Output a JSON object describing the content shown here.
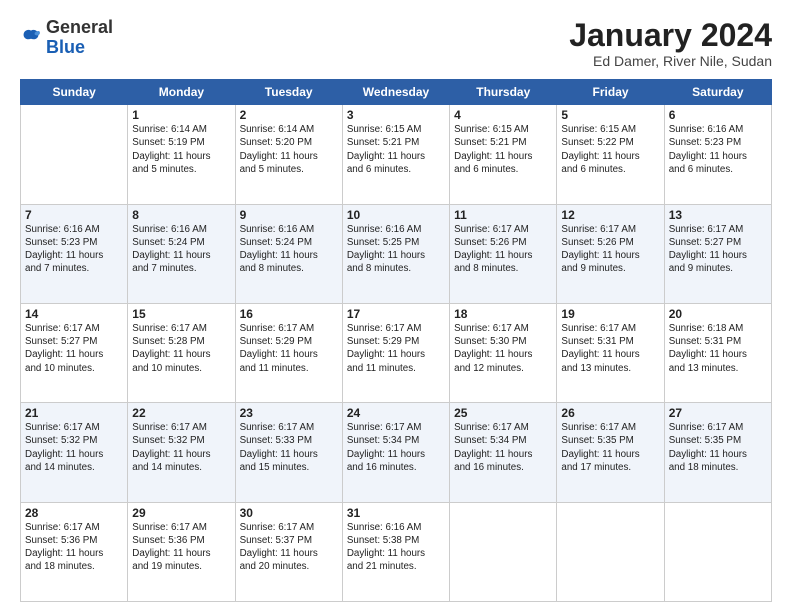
{
  "header": {
    "logo_general": "General",
    "logo_blue": "Blue",
    "month_title": "January 2024",
    "location": "Ed Damer, River Nile, Sudan"
  },
  "weekdays": [
    "Sunday",
    "Monday",
    "Tuesday",
    "Wednesday",
    "Thursday",
    "Friday",
    "Saturday"
  ],
  "weeks": [
    [
      {
        "day": "",
        "info": ""
      },
      {
        "day": "1",
        "info": "Sunrise: 6:14 AM\nSunset: 5:19 PM\nDaylight: 11 hours\nand 5 minutes."
      },
      {
        "day": "2",
        "info": "Sunrise: 6:14 AM\nSunset: 5:20 PM\nDaylight: 11 hours\nand 5 minutes."
      },
      {
        "day": "3",
        "info": "Sunrise: 6:15 AM\nSunset: 5:21 PM\nDaylight: 11 hours\nand 6 minutes."
      },
      {
        "day": "4",
        "info": "Sunrise: 6:15 AM\nSunset: 5:21 PM\nDaylight: 11 hours\nand 6 minutes."
      },
      {
        "day": "5",
        "info": "Sunrise: 6:15 AM\nSunset: 5:22 PM\nDaylight: 11 hours\nand 6 minutes."
      },
      {
        "day": "6",
        "info": "Sunrise: 6:16 AM\nSunset: 5:23 PM\nDaylight: 11 hours\nand 6 minutes."
      }
    ],
    [
      {
        "day": "7",
        "info": "Sunrise: 6:16 AM\nSunset: 5:23 PM\nDaylight: 11 hours\nand 7 minutes."
      },
      {
        "day": "8",
        "info": "Sunrise: 6:16 AM\nSunset: 5:24 PM\nDaylight: 11 hours\nand 7 minutes."
      },
      {
        "day": "9",
        "info": "Sunrise: 6:16 AM\nSunset: 5:24 PM\nDaylight: 11 hours\nand 8 minutes."
      },
      {
        "day": "10",
        "info": "Sunrise: 6:16 AM\nSunset: 5:25 PM\nDaylight: 11 hours\nand 8 minutes."
      },
      {
        "day": "11",
        "info": "Sunrise: 6:17 AM\nSunset: 5:26 PM\nDaylight: 11 hours\nand 8 minutes."
      },
      {
        "day": "12",
        "info": "Sunrise: 6:17 AM\nSunset: 5:26 PM\nDaylight: 11 hours\nand 9 minutes."
      },
      {
        "day": "13",
        "info": "Sunrise: 6:17 AM\nSunset: 5:27 PM\nDaylight: 11 hours\nand 9 minutes."
      }
    ],
    [
      {
        "day": "14",
        "info": "Sunrise: 6:17 AM\nSunset: 5:27 PM\nDaylight: 11 hours\nand 10 minutes."
      },
      {
        "day": "15",
        "info": "Sunrise: 6:17 AM\nSunset: 5:28 PM\nDaylight: 11 hours\nand 10 minutes."
      },
      {
        "day": "16",
        "info": "Sunrise: 6:17 AM\nSunset: 5:29 PM\nDaylight: 11 hours\nand 11 minutes."
      },
      {
        "day": "17",
        "info": "Sunrise: 6:17 AM\nSunset: 5:29 PM\nDaylight: 11 hours\nand 11 minutes."
      },
      {
        "day": "18",
        "info": "Sunrise: 6:17 AM\nSunset: 5:30 PM\nDaylight: 11 hours\nand 12 minutes."
      },
      {
        "day": "19",
        "info": "Sunrise: 6:17 AM\nSunset: 5:31 PM\nDaylight: 11 hours\nand 13 minutes."
      },
      {
        "day": "20",
        "info": "Sunrise: 6:18 AM\nSunset: 5:31 PM\nDaylight: 11 hours\nand 13 minutes."
      }
    ],
    [
      {
        "day": "21",
        "info": "Sunrise: 6:17 AM\nSunset: 5:32 PM\nDaylight: 11 hours\nand 14 minutes."
      },
      {
        "day": "22",
        "info": "Sunrise: 6:17 AM\nSunset: 5:32 PM\nDaylight: 11 hours\nand 14 minutes."
      },
      {
        "day": "23",
        "info": "Sunrise: 6:17 AM\nSunset: 5:33 PM\nDaylight: 11 hours\nand 15 minutes."
      },
      {
        "day": "24",
        "info": "Sunrise: 6:17 AM\nSunset: 5:34 PM\nDaylight: 11 hours\nand 16 minutes."
      },
      {
        "day": "25",
        "info": "Sunrise: 6:17 AM\nSunset: 5:34 PM\nDaylight: 11 hours\nand 16 minutes."
      },
      {
        "day": "26",
        "info": "Sunrise: 6:17 AM\nSunset: 5:35 PM\nDaylight: 11 hours\nand 17 minutes."
      },
      {
        "day": "27",
        "info": "Sunrise: 6:17 AM\nSunset: 5:35 PM\nDaylight: 11 hours\nand 18 minutes."
      }
    ],
    [
      {
        "day": "28",
        "info": "Sunrise: 6:17 AM\nSunset: 5:36 PM\nDaylight: 11 hours\nand 18 minutes."
      },
      {
        "day": "29",
        "info": "Sunrise: 6:17 AM\nSunset: 5:36 PM\nDaylight: 11 hours\nand 19 minutes."
      },
      {
        "day": "30",
        "info": "Sunrise: 6:17 AM\nSunset: 5:37 PM\nDaylight: 11 hours\nand 20 minutes."
      },
      {
        "day": "31",
        "info": "Sunrise: 6:16 AM\nSunset: 5:38 PM\nDaylight: 11 hours\nand 21 minutes."
      },
      {
        "day": "",
        "info": ""
      },
      {
        "day": "",
        "info": ""
      },
      {
        "day": "",
        "info": ""
      }
    ]
  ]
}
